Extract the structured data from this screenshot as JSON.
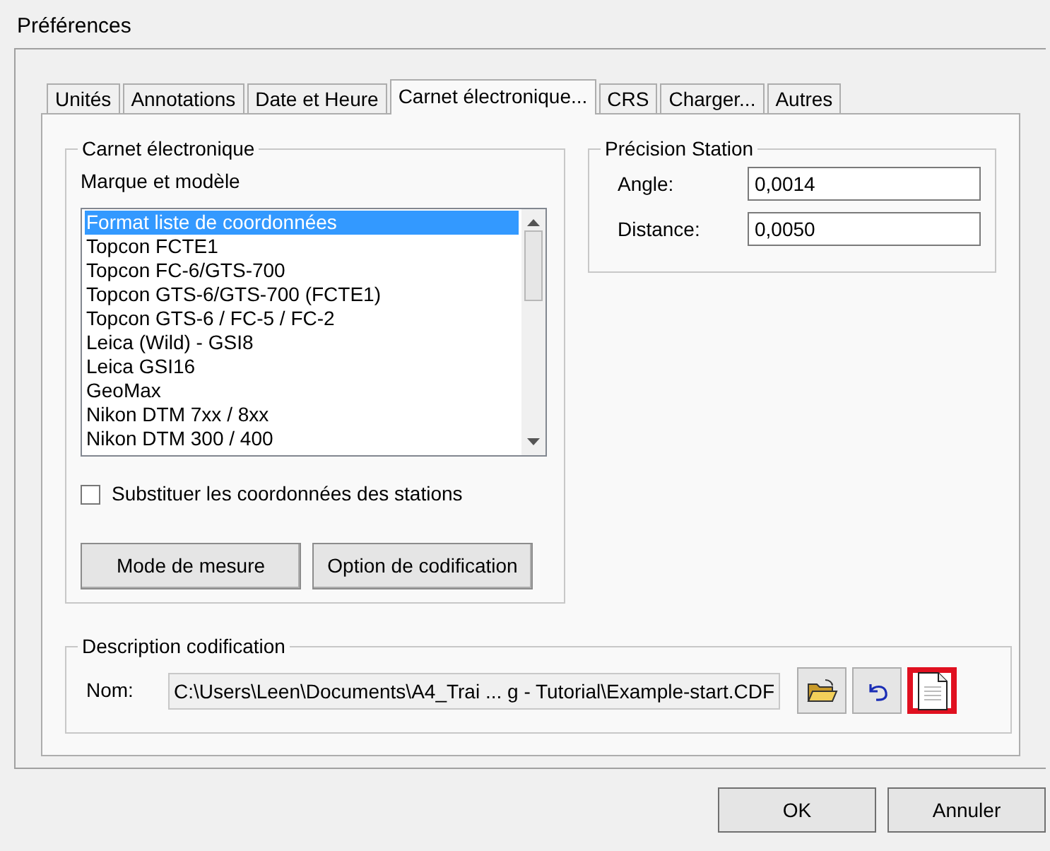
{
  "window": {
    "title": "Préférences"
  },
  "tabs": [
    {
      "label": "Unités",
      "selected": false
    },
    {
      "label": "Annotations",
      "selected": false
    },
    {
      "label": "Date et Heure",
      "selected": false
    },
    {
      "label": "Carnet électronique...",
      "selected": true
    },
    {
      "label": "CRS",
      "selected": false
    },
    {
      "label": "Charger...",
      "selected": false
    },
    {
      "label": "Autres",
      "selected": false
    }
  ],
  "carnet": {
    "title": "Carnet électronique",
    "list_label": "Marque et modèle",
    "items": [
      {
        "label": "Format liste de coordonnées",
        "selected": true
      },
      {
        "label": "Topcon FCTE1",
        "selected": false
      },
      {
        "label": "Topcon FC-6/GTS-700",
        "selected": false
      },
      {
        "label": "Topcon GTS-6/GTS-700 (FCTE1)",
        "selected": false
      },
      {
        "label": "Topcon GTS-6 / FC-5 / FC-2",
        "selected": false
      },
      {
        "label": "Leica (Wild) - GSI8",
        "selected": false
      },
      {
        "label": "Leica GSI16",
        "selected": false
      },
      {
        "label": "GeoMax",
        "selected": false
      },
      {
        "label": "Nikon DTM 7xx / 8xx",
        "selected": false
      },
      {
        "label": "Nikon DTM 300 / 400",
        "selected": false
      }
    ],
    "checkbox": {
      "label": "Substituer les coordonnées des stations",
      "checked": false
    },
    "buttons": [
      "Mode de mesure",
      "Option de codification"
    ]
  },
  "precision": {
    "title": "Précision Station",
    "fields": [
      {
        "label": "Angle:",
        "value": "0,0014"
      },
      {
        "label": "Distance:",
        "value": "0,0050"
      }
    ]
  },
  "codification": {
    "title": "Description codification",
    "label": "Nom:",
    "value": "C:\\Users\\Leen\\Documents\\A4_Trai ... g - Tutorial\\Example-start.CDF",
    "tools": [
      {
        "kind": "open",
        "highlighted": false
      },
      {
        "kind": "undo",
        "highlighted": false
      },
      {
        "kind": "new",
        "highlighted": true
      }
    ]
  },
  "buttons": [
    "OK",
    "Annuler"
  ]
}
